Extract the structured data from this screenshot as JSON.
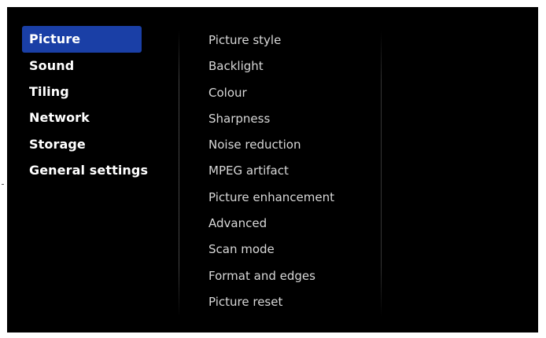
{
  "categories": [
    {
      "label": "Picture",
      "selected": true
    },
    {
      "label": "Sound",
      "selected": false
    },
    {
      "label": "Tiling",
      "selected": false
    },
    {
      "label": "Network",
      "selected": false
    },
    {
      "label": "Storage",
      "selected": false
    },
    {
      "label": "General settings",
      "selected": false
    }
  ],
  "submenu": [
    "Picture style",
    "Backlight",
    "Colour",
    "Sharpness",
    "Noise reduction",
    "MPEG artifact",
    "Picture enhancement",
    "Advanced",
    "Scan mode",
    "Format and edges",
    "Picture reset"
  ],
  "colors": {
    "background": "#000000",
    "selection": "#1a3fa6",
    "text": "#ffffff",
    "submenu_text": "#d8d8d8"
  }
}
